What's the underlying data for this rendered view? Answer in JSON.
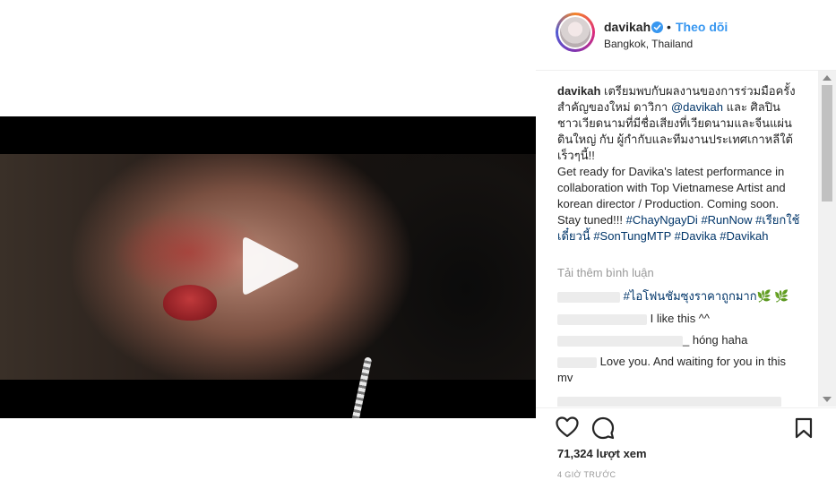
{
  "header": {
    "username": "davikah",
    "dot": "•",
    "follow_label": "Theo dõi",
    "location": "Bangkok, Thailand"
  },
  "caption": {
    "username": "davikah",
    "text_thai_1": " เตรียมพบกับผลงานของการร่วมมือครั้งสำคัญของใหม่ ดาวิกา ",
    "mention": "@davikah",
    "text_thai_2": " และ ศิลปินชาวเวียดนามที่มีชื่อเสียงที่เวียดนามและจีนแผ่นดินใหญ่ กับ ผู้กำกับและทีมงานประเทศเกาหลีใต้ เร็วๆนี้!!",
    "text_en": "Get ready for Davika's latest performance in collaboration with Top Vietnamese Artist and korean director / Production. Coming soon. Stay tuned!!! ",
    "hashtags": [
      "#ChayNgayDi",
      "#RunNow",
      "#เรียกใช้เดี๋ยวนี้",
      "#SonTungMTP",
      "#Davika",
      "#Davikah"
    ]
  },
  "load_more": "Tải thêm bình luận",
  "comments": [
    {
      "text": "#ไอโฟนชัมซุงราคาถูกมาก🌿 🌿"
    },
    {
      "text": "I like this ^^"
    },
    {
      "text": "_ hóng haha"
    },
    {
      "text": "Love you. And waiting for you in this mv"
    }
  ],
  "stats": {
    "views": "71,324 lượt xem",
    "time": "4 GIỜ TRƯỚC"
  },
  "colors": {
    "link": "#003569",
    "follow": "#3897f0",
    "muted": "#999999",
    "verified": "#3897f0"
  },
  "icons": {
    "play": "play-icon",
    "like": "heart-icon",
    "comment": "comment-icon",
    "save": "bookmark-icon",
    "verified": "verified-badge-icon"
  }
}
